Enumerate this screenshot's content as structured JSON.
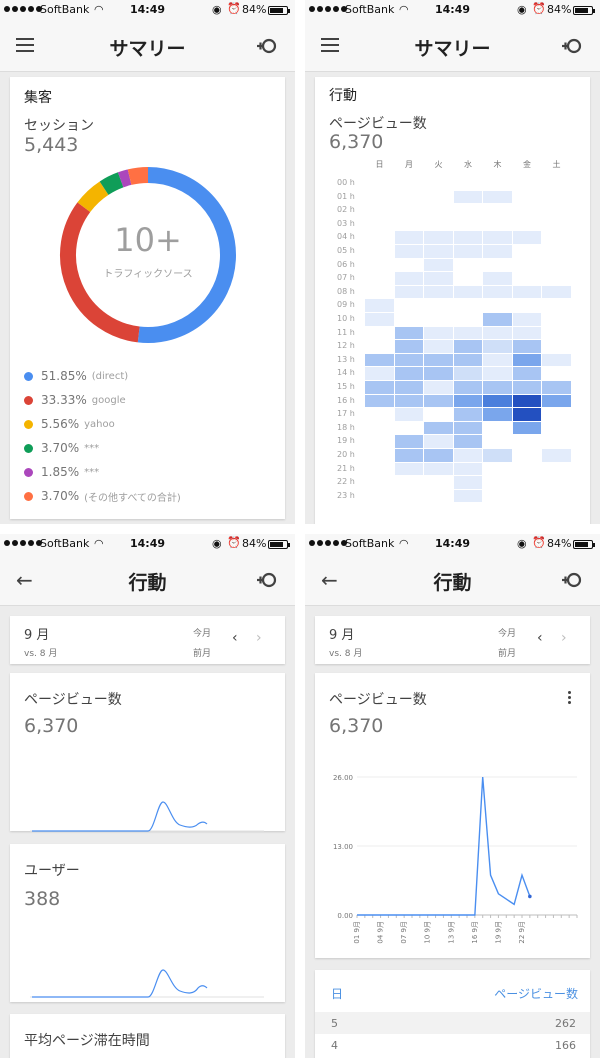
{
  "status_bar": {
    "carrier": "SoftBank",
    "time": "14:49",
    "battery": "84%",
    "battery_level": 0.84
  },
  "screen1": {
    "title": "サマリー",
    "card_title": "集客",
    "metric_label": "セッション",
    "metric_value": "5,443",
    "donut_center_value": "10+",
    "donut_center_label": "トラフィックソース",
    "sources": [
      {
        "pct": "51.85%",
        "label": "(direct)",
        "value": 51.85,
        "color": "#4a8ef0"
      },
      {
        "pct": "33.33%",
        "label": "google",
        "value": 33.33,
        "color": "#db4437"
      },
      {
        "pct": "5.56%",
        "label": "yahoo",
        "value": 5.56,
        "color": "#f4b400"
      },
      {
        "pct": "3.70%",
        "label": "***",
        "value": 3.7,
        "color": "#0f9d58"
      },
      {
        "pct": "1.85%",
        "label": "***",
        "value": 1.85,
        "color": "#ab47bc"
      },
      {
        "pct": "3.70%",
        "label": "(その他すべての合計)",
        "value": 3.7,
        "color": "#ff7043"
      }
    ]
  },
  "screen2": {
    "title": "サマリー",
    "card_title": "行動",
    "metric_label": "ページビュー数",
    "metric_value": "6,370",
    "days": [
      "日",
      "月",
      "火",
      "水",
      "木",
      "金",
      "土"
    ],
    "hours": [
      "00 h",
      "01 h",
      "02 h",
      "03 h",
      "04 h",
      "05 h",
      "06 h",
      "07 h",
      "08 h",
      "09 h",
      "10 h",
      "11 h",
      "12 h",
      "13 h",
      "14 h",
      "15 h",
      "16 h",
      "17 h",
      "18 h",
      "19 h",
      "20 h",
      "21 h",
      "22 h",
      "23 h"
    ],
    "heatmap": [
      [
        0,
        0,
        0,
        0,
        0,
        0,
        0
      ],
      [
        0,
        0,
        0,
        1,
        1,
        0,
        0
      ],
      [
        0,
        0,
        0,
        0,
        0,
        0,
        0
      ],
      [
        0,
        0,
        0,
        0,
        0,
        0,
        0
      ],
      [
        0,
        1,
        1,
        1,
        1,
        1,
        0
      ],
      [
        0,
        1,
        1,
        1,
        1,
        0,
        0
      ],
      [
        0,
        0,
        1,
        0,
        0,
        0,
        0
      ],
      [
        0,
        1,
        1,
        0,
        1,
        0,
        0
      ],
      [
        0,
        1,
        1,
        1,
        1,
        1,
        1
      ],
      [
        1,
        0,
        0,
        0,
        0,
        0,
        0
      ],
      [
        1,
        0,
        0,
        0,
        3,
        1,
        0
      ],
      [
        0,
        3,
        1,
        1,
        1,
        1,
        0
      ],
      [
        0,
        3,
        1,
        3,
        2,
        3,
        0
      ],
      [
        3,
        3,
        3,
        3,
        1,
        4,
        1
      ],
      [
        1,
        3,
        3,
        2,
        1,
        3,
        0
      ],
      [
        3,
        3,
        1,
        3,
        3,
        3,
        3
      ],
      [
        3,
        3,
        3,
        4,
        5,
        6,
        4
      ],
      [
        0,
        1,
        0,
        3,
        4,
        6,
        0
      ],
      [
        0,
        0,
        3,
        3,
        0,
        4,
        0
      ],
      [
        0,
        3,
        1,
        3,
        0,
        0,
        0
      ],
      [
        0,
        3,
        3,
        1,
        2,
        0,
        1
      ],
      [
        0,
        1,
        1,
        1,
        0,
        0,
        0
      ],
      [
        0,
        0,
        0,
        1,
        0,
        0,
        0
      ],
      [
        0,
        0,
        0,
        1,
        0,
        0,
        0
      ]
    ]
  },
  "screen3": {
    "title": "行動",
    "period_month": "9 月",
    "period_compare": "vs. 8 月",
    "period_current": "今月",
    "period_previous": "前月",
    "cards": [
      {
        "label": "ページビュー数",
        "value": "6,370"
      },
      {
        "label": "ユーザー",
        "value": "388"
      },
      {
        "label": "平均ページ滞在時間",
        "value": ""
      }
    ]
  },
  "screen4": {
    "title": "行動",
    "period_month": "9 月",
    "period_compare": "vs. 8 月",
    "period_current": "今月",
    "period_previous": "前月",
    "card_label": "ページビュー数",
    "card_value": "6,370",
    "table_header_day": "日",
    "table_header_pv": "ページビュー数",
    "table_rows": [
      {
        "day": "5",
        "value": "262"
      },
      {
        "day": "4",
        "value": "166"
      }
    ]
  },
  "chart_data": [
    {
      "type": "line",
      "title": "",
      "xlabel": "",
      "ylabel": "",
      "x": [
        "01 9月",
        "02 9月",
        "03 9月",
        "04 9月",
        "05 9月",
        "06 9月",
        "07 9月",
        "08 9月",
        "09 9月",
        "10 9月",
        "11 9月",
        "12 9月",
        "13 9月",
        "14 9月",
        "15 9月",
        "16 9月",
        "17 9月",
        "18 9月",
        "19 9月",
        "20 9月",
        "21 9月",
        "22 9月",
        "23 9月",
        "24 9月"
      ],
      "x_tick_labels": [
        "01 9月",
        "04 9月",
        "07 9月",
        "10 9月",
        "13 9月",
        "16 9月",
        "19 9月",
        "22 9月"
      ],
      "y_tick_labels": [
        "0.00",
        "13.00",
        "26.00"
      ],
      "ylim": [
        0,
        26
      ],
      "series": [
        {
          "values": [
            0,
            0,
            0,
            0,
            0,
            0,
            0,
            0,
            0,
            0,
            0,
            0,
            0,
            0,
            0,
            0,
            26,
            7.5,
            4,
            3,
            2,
            7.5,
            3.5,
            null
          ]
        }
      ],
      "grid": true,
      "color": "#4a8ef0"
    }
  ]
}
